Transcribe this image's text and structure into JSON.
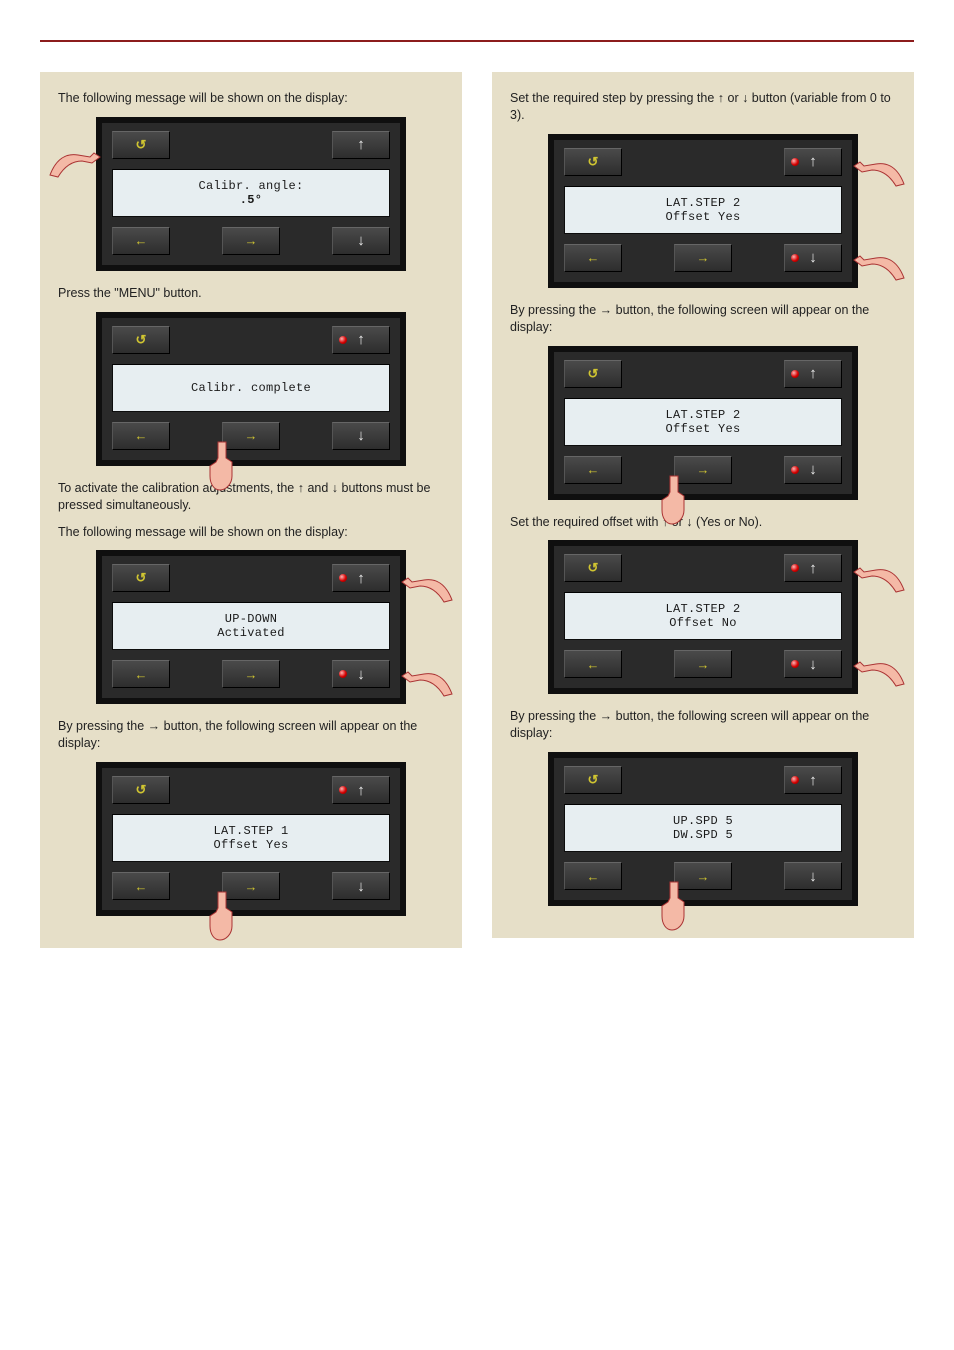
{
  "leftGroup": {
    "intro": "The following message will be shown on the display:",
    "s1": {
      "lcd1": "Calibr. angle:",
      "lcd2": ".5°"
    },
    "caption1": "Press the \"MENU\" button.",
    "s2": {
      "lcd1": "Calibr. complete",
      "lcd2": ""
    },
    "caption2_pre": "To activate the calibration adjustments, the ",
    "caption2_mid": "  and  ",
    "caption2_post": " buttons must be pressed simultaneously.",
    "caption3": "The following message will be shown on the display:",
    "s3": {
      "lcd1": "UP-DOWN",
      "lcd2": "Activated"
    },
    "caption4_pre": "By pressing the ",
    "caption4_post": " button, the following screen will appear on the display:",
    "s4": {
      "lcd1": "LAT.STEP        1",
      "lcd2": "Offset          Yes"
    }
  },
  "rightGroup": {
    "caption0_pre": "Set the required step by pressing the ",
    "caption0_mid": " or ",
    "caption0_post": " button (variable from 0 to 3).",
    "s1": {
      "lcd1": "LAT.STEP        2",
      "lcd2": "Offset          Yes"
    },
    "caption1_pre": "By pressing the ",
    "caption1_post": " button, the following screen will appear on the display:",
    "s2": {
      "lcd1": "LAT.STEP       2",
      "lcd2": "Offset         Yes"
    },
    "caption2_pre": "Set the required offset with ",
    "caption2_mid": " or ",
    "caption2_post": " (Yes or No).",
    "s3": {
      "lcd1": "LAT.STEP       2",
      "lcd2": "Offset         No"
    },
    "caption3_pre": "By pressing the ",
    "caption3_post": " button, the following screen will appear on the display:",
    "s4": {
      "lcd1": "UP.SPD         5",
      "lcd2": "DW.SPD         5"
    }
  }
}
